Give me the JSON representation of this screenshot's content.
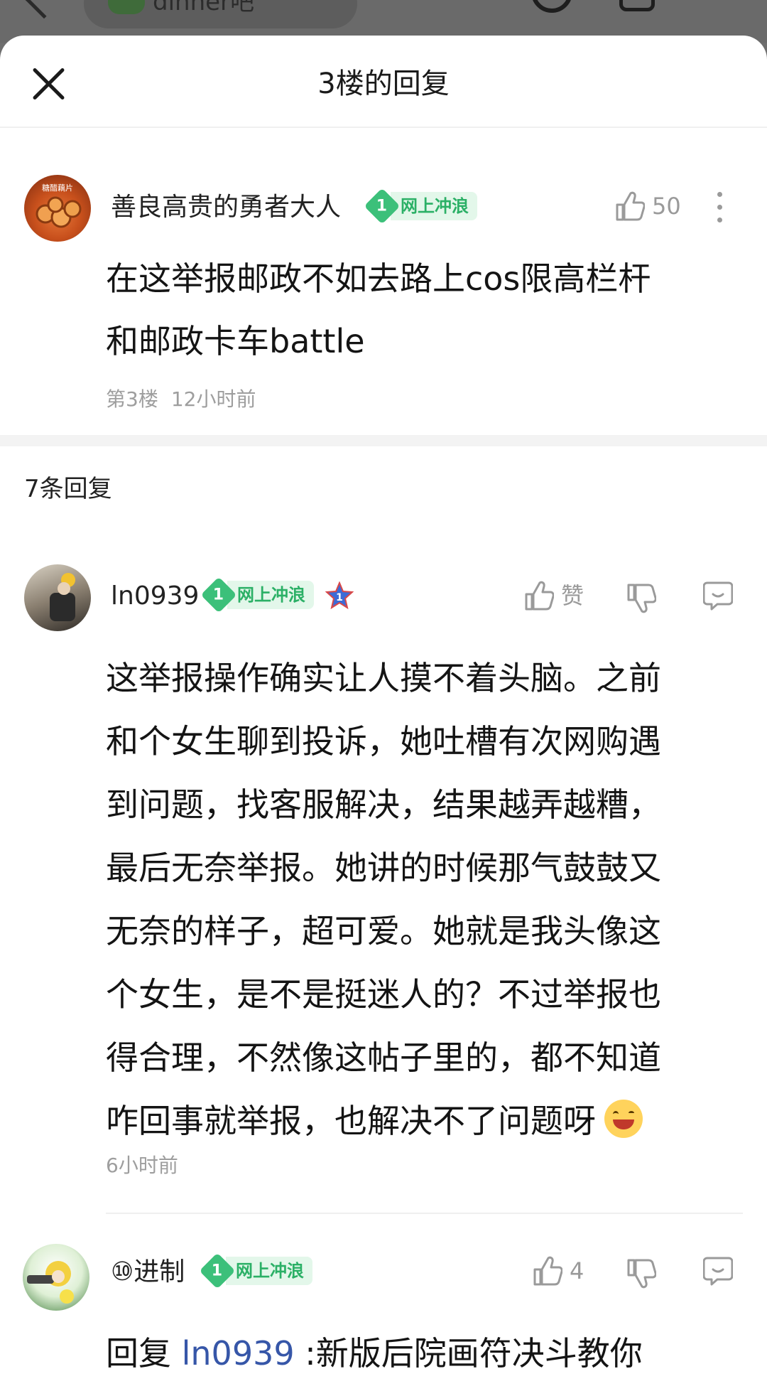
{
  "background": {
    "forum_name": "dinner吧"
  },
  "sheet": {
    "title": "3楼的回复"
  },
  "main_post": {
    "username": "善良高贵的勇者大人",
    "avatar_text": "糖醋藕片",
    "badge_level": "1",
    "badge_text": "网上冲浪",
    "like_count": "50",
    "content_line1": "在这举报邮政不如去路上cos限高栏杆",
    "content_line2": "和邮政卡车battle",
    "floor": "第3楼",
    "time": "12小时前"
  },
  "replies_header": "7条回复",
  "replies": [
    {
      "username": "ln0939",
      "badge_level": "1",
      "badge_text": "网上冲浪",
      "vip_level": "1",
      "like_label": "赞",
      "content_lines": [
        "这举报操作确实让人摸不着头脑。之前",
        "和个女生聊到投诉，她吐槽有次网购遇",
        "到问题，找客服解决，结果越弄越糟，",
        "最后无奈举报。她讲的时候那气鼓鼓又",
        "无奈的样子，超可爱。她就是我头像这",
        "个女生，是不是挺迷人的？不过举报也",
        "得合理，不然像这帖子里的，都不知道",
        "咋回事就举报，也解决不了问题呀"
      ],
      "time": "6小时前"
    },
    {
      "username": "⑩进制",
      "badge_level": "1",
      "badge_text": "网上冲浪",
      "like_count": "4",
      "reply_prefix": "回复",
      "mention": "ln0939",
      "content": " :新版后院画符决斗教你"
    }
  ],
  "colors": {
    "badge_green": "#3cc07a",
    "badge_bg": "#e3f7ea",
    "mention_blue": "#3656a8",
    "meta_gray": "#9e9e9e"
  }
}
